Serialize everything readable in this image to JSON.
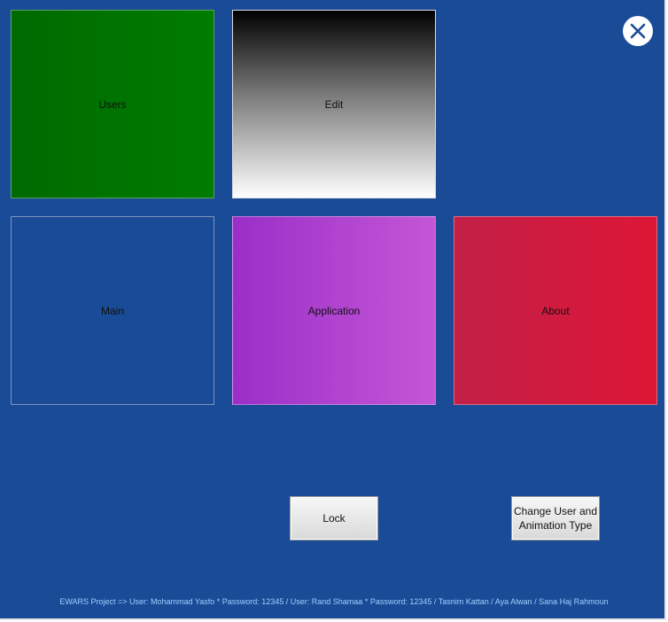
{
  "tiles": {
    "users": "Users",
    "edit": "Edit",
    "main": "Main",
    "application": "Application",
    "about": "About"
  },
  "buttons": {
    "lock": "Lock",
    "change_user": "Change User and Animation Type"
  },
  "footer": {
    "text": "EWARS Project  =>  User: Mohammad Yasfo * Password: 12345 / User: Rand Shamaa * Password: 12345 / Tasnim Kattan / Aya Alwan / Sana Haj Rahmoun"
  },
  "icons": {
    "close": "close-icon"
  },
  "colors": {
    "background": "#1a4b97",
    "users_tile": "#007c00",
    "application_tile": "#c556d6",
    "about_tile": "#de1636",
    "footer_text": "#9fd1ff"
  }
}
